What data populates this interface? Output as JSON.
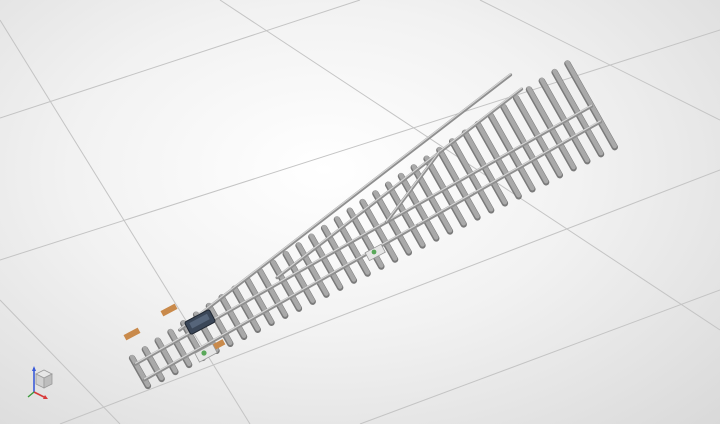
{
  "viewport": {
    "kind": "3d-model-viewport",
    "model": "track-turnout",
    "grid": true,
    "background": "#f2f2f2"
  },
  "colors": {
    "rail": "#8f8f8f",
    "rail_highlight": "#d4d4d4",
    "sleeper": "#a9a9a9",
    "sleeper_dark": "#7a7a7a",
    "grid_line": "#c4c4c4",
    "motor": "#3b4758",
    "clip": "#c98a4b",
    "connector": "#5aa85a",
    "axis_x": "#d83a3a",
    "axis_y": "#3a9a3a",
    "axis_z": "#3a5ad8"
  },
  "icons": {
    "axis_triad": "xyz-axis-triad-icon"
  }
}
